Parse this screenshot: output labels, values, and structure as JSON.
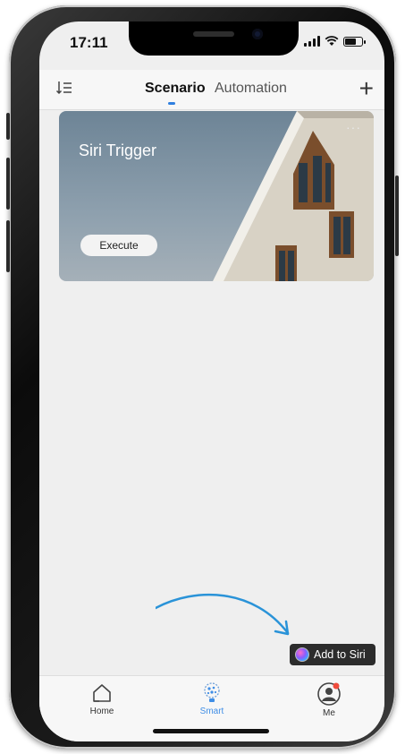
{
  "status_bar": {
    "time": "17:11"
  },
  "header": {
    "tabs": [
      {
        "label": "Scenario",
        "active": true
      },
      {
        "label": "Automation",
        "active": false
      }
    ],
    "accent_color": "#2f7fe0"
  },
  "scene_card": {
    "title": "Siri Trigger",
    "execute_label": "Execute",
    "more_label": "···"
  },
  "siri": {
    "label": "Add to Siri"
  },
  "bottom_nav": {
    "items": [
      {
        "label": "Home",
        "icon": "house-icon",
        "active": false
      },
      {
        "label": "Smart",
        "icon": "smart-bulb-icon",
        "active": true
      },
      {
        "label": "Me",
        "icon": "avatar-icon",
        "active": false
      }
    ],
    "active_color": "#3f8ee6"
  }
}
